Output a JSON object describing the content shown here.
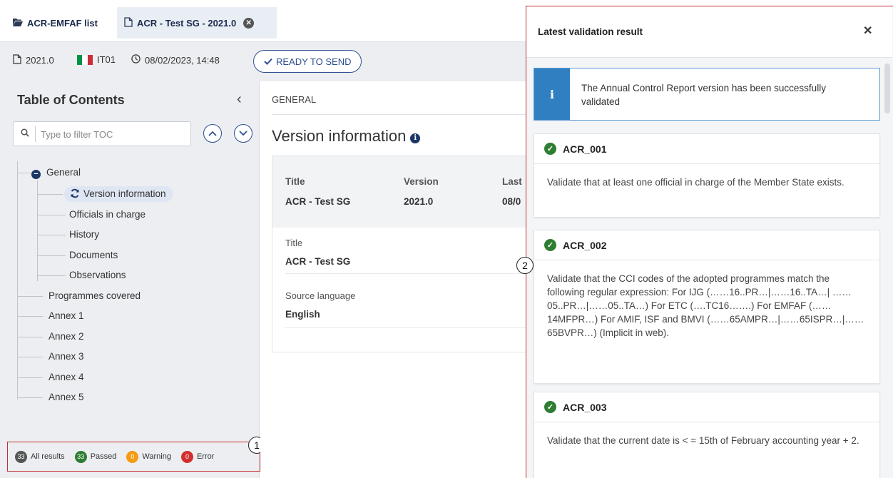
{
  "tabs": [
    {
      "label": "ACR-EMFAF list",
      "icon": "folder-open-icon"
    },
    {
      "label": "ACR - Test SG - 2021.0",
      "icon": "document-icon",
      "closable": true
    }
  ],
  "meta": {
    "version": "2021.0",
    "country": "IT01",
    "timestamp": "08/02/2023, 14:48",
    "status": "READY TO SEND",
    "flag_colors": [
      "#009246",
      "#ffffff",
      "#ce2b37"
    ]
  },
  "toc": {
    "title": "Table of Contents",
    "filter_placeholder": "Type to filter TOC",
    "items": {
      "general": "General",
      "version_information": "Version information",
      "officials_in_charge": "Officials in charge",
      "history": "History",
      "documents": "Documents",
      "observations": "Observations",
      "programmes_covered": "Programmes covered",
      "annex1": "Annex 1",
      "annex2": "Annex 2",
      "annex3": "Annex 3",
      "annex4": "Annex 4",
      "annex5": "Annex 5"
    },
    "legend": {
      "all": {
        "count": "33",
        "label": "All results",
        "color": "#555555"
      },
      "passed": {
        "count": "33",
        "label": "Passed",
        "color": "#2e7d32"
      },
      "warning": {
        "count": "0",
        "label": "Warning",
        "color": "#f39c12"
      },
      "error": {
        "count": "0",
        "label": "Error",
        "color": "#d32f2f"
      }
    }
  },
  "markers": {
    "one": "1",
    "two": "2"
  },
  "main": {
    "section": "GENERAL",
    "title": "Version information",
    "header": {
      "title_label": "Title",
      "title_value": "ACR - Test SG",
      "version_label": "Version",
      "version_value": "2021.0",
      "last_label": "Last",
      "last_value": "08/0"
    },
    "fields": {
      "title_label": "Title",
      "title_value": "ACR - Test SG",
      "language_label": "Source language",
      "language_value": "English"
    }
  },
  "panel": {
    "title": "Latest validation result",
    "alert": "The Annual Control Report version has been successfully validated",
    "results": [
      {
        "code": "ACR_001",
        "text": "Validate that at least one official in charge of the Member State exists."
      },
      {
        "code": "ACR_002",
        "text": "Validate that the CCI codes of the adopted programmes match the following regular expression: For IJG (……16..PR…|……16..TA…| ……05..PR…|……05..TA…) For ETC (….TC16…….) For EMFAF (……14MFPR…) For AMIF, ISF and BMVI (……65AMPR…|……65ISPR…|……65BVPR…) (Implicit in web)."
      },
      {
        "code": "ACR_003",
        "text": "Validate that the current date is < = 15th of February accounting year + 2."
      }
    ]
  }
}
